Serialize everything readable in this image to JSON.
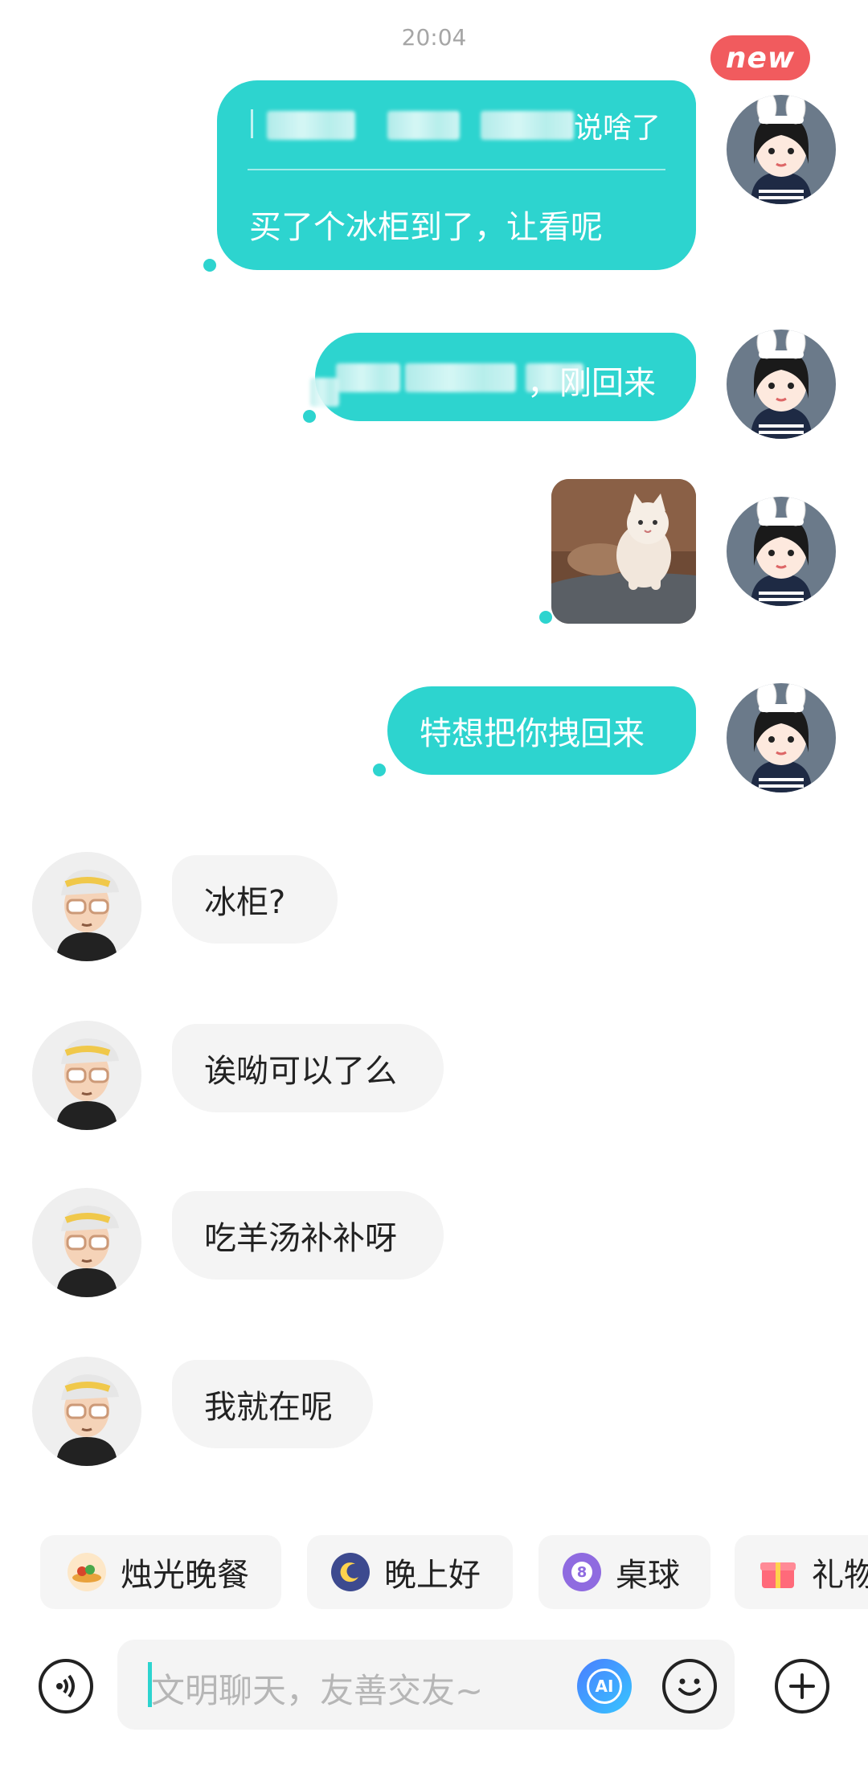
{
  "header": {
    "time": "20:04",
    "new_badge": "new"
  },
  "messages": {
    "m1_quote_tail": "说啥了",
    "m1_text": "买了个冰柜到了，让看呢",
    "m2_tail": "，刚回来",
    "m4_text": "特想把你拽回来",
    "r1_text": "冰柜?",
    "r2_text": "诶呦可以了么",
    "r3_text": "吃羊汤补补呀",
    "r4_text": "我就在呢"
  },
  "quick_replies": [
    {
      "label": "烛光晚餐",
      "icon": "candlelight-dinner-icon"
    },
    {
      "label": "晚上好",
      "icon": "moon-icon"
    },
    {
      "label": "桌球",
      "icon": "billiard-ball-icon",
      "badge": "8"
    },
    {
      "label": "礼物",
      "icon": "gift-icon"
    }
  ],
  "input": {
    "placeholder": "文明聊天，友善交友~",
    "ai_label": "AI"
  },
  "colors": {
    "accent": "#2dd4cf",
    "badge": "#f15b5e",
    "incoming_bubble": "#f4f4f4"
  }
}
